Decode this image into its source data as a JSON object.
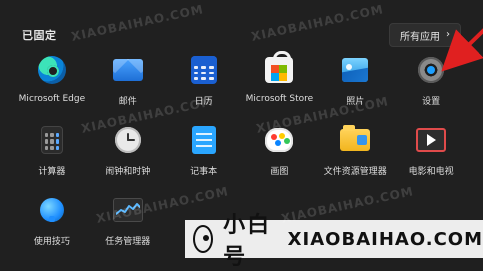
{
  "start_menu": {
    "pinned_title": "已固定",
    "all_apps_label": "所有应用",
    "all_apps_chevron": "›",
    "apps": [
      {
        "label": "Microsoft Edge",
        "icon": "edge-icon"
      },
      {
        "label": "邮件",
        "icon": "mail-icon"
      },
      {
        "label": "日历",
        "icon": "calendar-icon"
      },
      {
        "label": "Microsoft Store",
        "icon": "store-icon"
      },
      {
        "label": "照片",
        "icon": "photos-icon"
      },
      {
        "label": "设置",
        "icon": "settings-icon"
      },
      {
        "label": "计算器",
        "icon": "calculator-icon"
      },
      {
        "label": "闹钟和时钟",
        "icon": "alarm-clock-icon"
      },
      {
        "label": "记事本",
        "icon": "notepad-icon"
      },
      {
        "label": "画图",
        "icon": "paint-icon"
      },
      {
        "label": "文件资源管理器",
        "icon": "file-explorer-icon"
      },
      {
        "label": "电影和电视",
        "icon": "movies-tv-icon"
      },
      {
        "label": "使用技巧",
        "icon": "tips-icon"
      },
      {
        "label": "任务管理器",
        "icon": "task-manager-icon"
      }
    ]
  },
  "annotations": {
    "arrow_color": "#e02020"
  },
  "watermarks": {
    "text": "XIAOBAIHAO.COM"
  },
  "brand_bar": {
    "name": "小白号",
    "domain": "XIAOBAIHAO.COM"
  }
}
